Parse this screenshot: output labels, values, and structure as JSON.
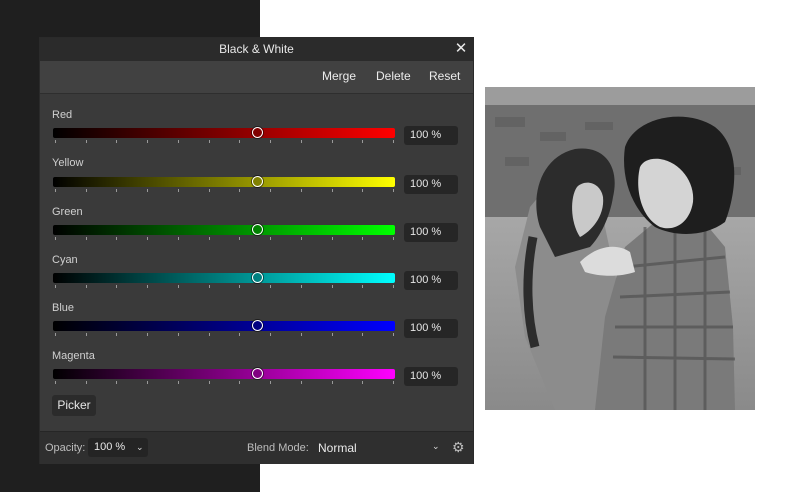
{
  "panel": {
    "title": "Black & White",
    "actions": {
      "merge": "Merge",
      "delete": "Delete",
      "reset": "Reset"
    },
    "sliders": [
      {
        "label": "Red",
        "value": "100 %",
        "level": 0.6,
        "color": "#ff0000"
      },
      {
        "label": "Yellow",
        "value": "100 %",
        "level": 0.6,
        "color": "#ffff00"
      },
      {
        "label": "Green",
        "value": "100 %",
        "level": 0.6,
        "color": "#00ff00"
      },
      {
        "label": "Cyan",
        "value": "100 %",
        "level": 0.6,
        "color": "#00ffff"
      },
      {
        "label": "Blue",
        "value": "100 %",
        "level": 0.6,
        "color": "#0000ff"
      },
      {
        "label": "Magenta",
        "value": "100 %",
        "level": 0.6,
        "color": "#ff00ff"
      }
    ],
    "picker_label": "Picker",
    "footer": {
      "opacity_label": "Opacity:",
      "opacity_value": "100 %",
      "blend_label": "Blend Mode:",
      "blend_value": "Normal"
    }
  },
  "icons": {
    "close": "close-icon",
    "gear": "gear-icon",
    "dropdown": "chevron-down-icon"
  }
}
